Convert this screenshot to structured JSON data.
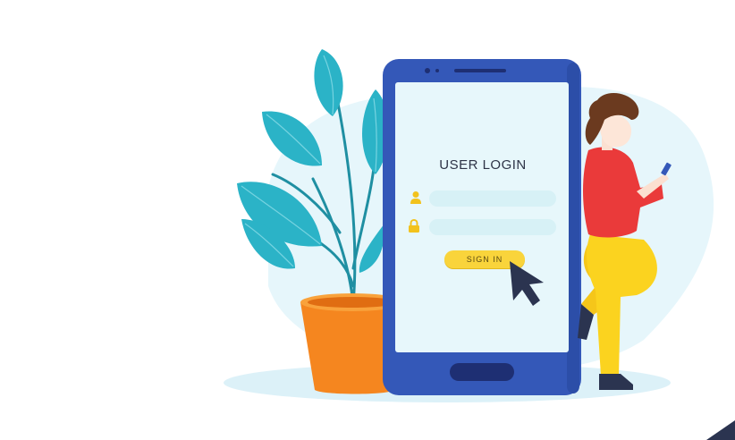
{
  "login": {
    "title": "USER LOGIN",
    "signin_label": "SIGN IN"
  },
  "colors": {
    "phone_frame": "#3458b8",
    "screen": "#e7f7fb",
    "button": "#f9d43b",
    "leaf": "#2bb3c7",
    "pot": "#f5861f",
    "shirt": "#ea3a3a",
    "pants": "#fbd31f",
    "bg_blob": "#e6f6fb"
  },
  "icons": {
    "user": "user-icon",
    "lock": "lock-icon",
    "cursor": "cursor-arrow-icon"
  }
}
